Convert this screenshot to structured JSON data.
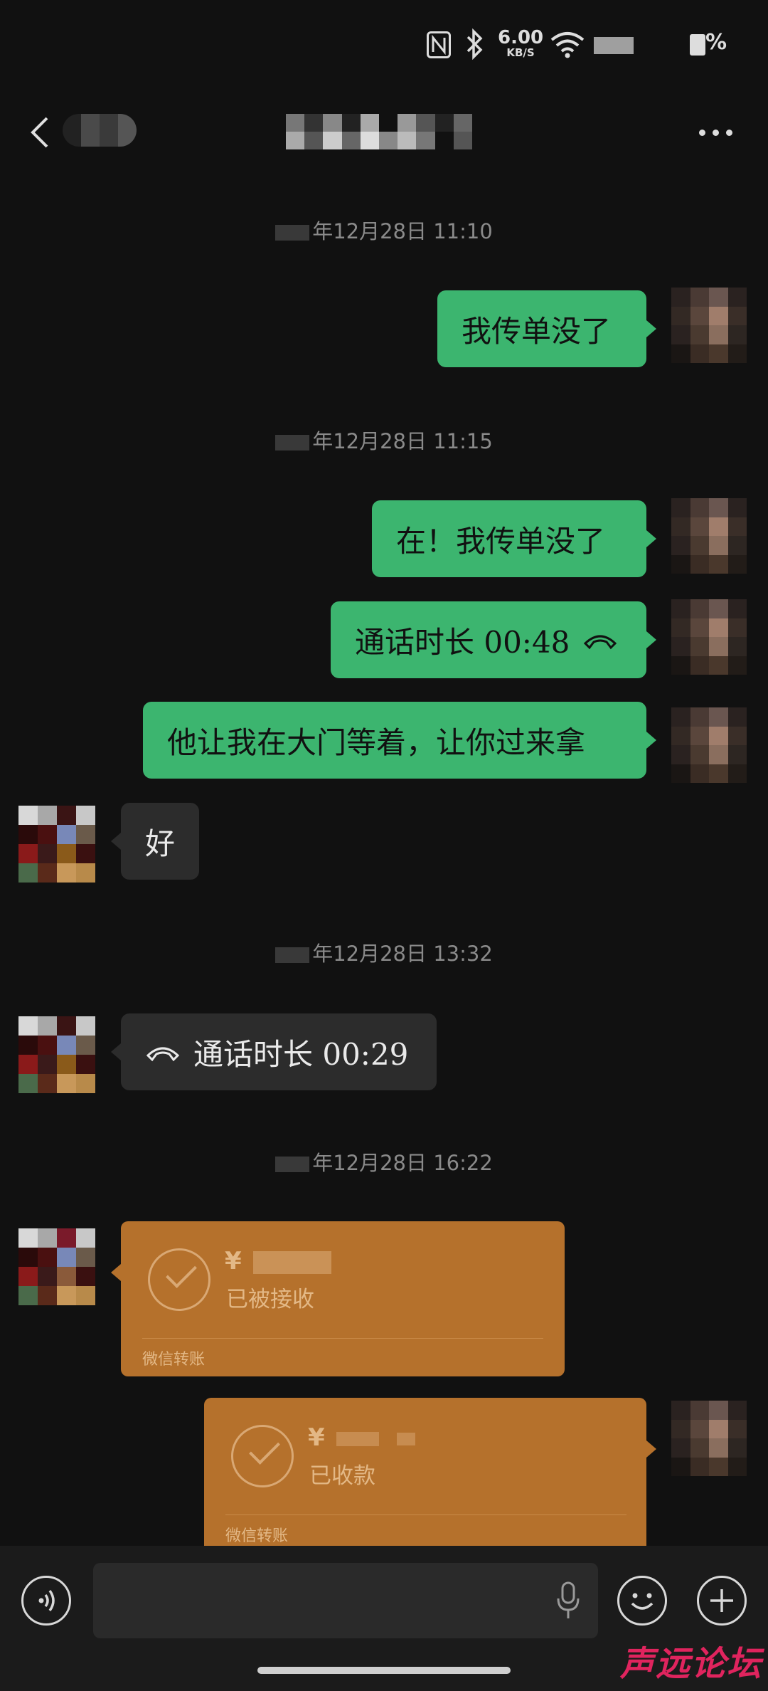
{
  "status_bar": {
    "speed_value": "6.00",
    "speed_unit": "KB/S",
    "battery_suffix": "%"
  },
  "header": {
    "back_icon": "chevron-left-icon",
    "more_icon": "more-dots-icon"
  },
  "messages": [
    {
      "type": "time",
      "text": "年12月28日 11:10"
    },
    {
      "type": "text",
      "from": "me",
      "text": "我传单没了"
    },
    {
      "type": "time",
      "text": "年12月28日 11:15"
    },
    {
      "type": "text",
      "from": "me",
      "text": "在！我传单没了"
    },
    {
      "type": "call",
      "from": "me",
      "text": "通话时长 00:48"
    },
    {
      "type": "text",
      "from": "me",
      "text": "他让我在大门等着，让你过来拿"
    },
    {
      "type": "text",
      "from": "them",
      "text": "好"
    },
    {
      "type": "time",
      "text": "年12月28日 13:32"
    },
    {
      "type": "call",
      "from": "them",
      "text": "通话时长 00:29"
    },
    {
      "type": "time",
      "text": "年12月28日 16:22"
    },
    {
      "type": "transfer",
      "from": "them",
      "currency": "¥",
      "status": "已被接收",
      "footer": "微信转账"
    },
    {
      "type": "transfer",
      "from": "me",
      "currency": "¥",
      "status": "已收款",
      "footer": "微信转账"
    }
  ],
  "input_bar": {
    "voice_icon": "voice-mode-icon",
    "mic_icon": "microphone-icon",
    "emoji_icon": "emoji-icon",
    "plus_icon": "plus-icon"
  },
  "watermark": "声远论坛",
  "colors": {
    "my_bubble": "#3cb56f",
    "their_bubble": "#2c2c2c",
    "transfer": "#b5712c",
    "background": "#111111"
  }
}
